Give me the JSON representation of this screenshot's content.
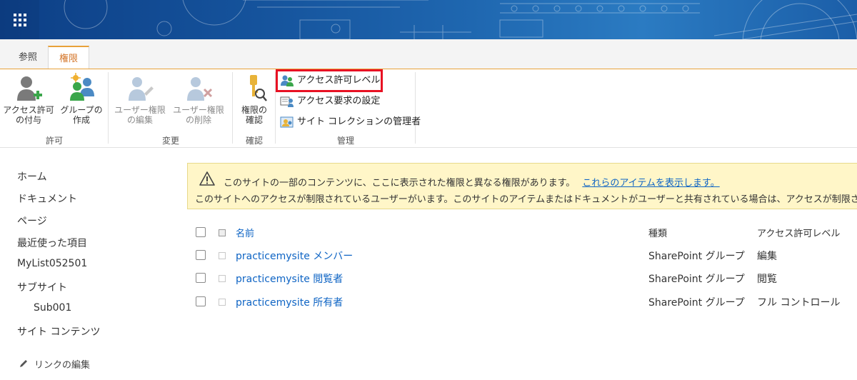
{
  "ribbon": {
    "tabs": [
      {
        "label": "参照"
      },
      {
        "label": "権限"
      }
    ],
    "groups": {
      "grant": {
        "label": "許可",
        "grant_perm": "アクセス許可\nの付与",
        "create_group": "グループの\n作成"
      },
      "modify": {
        "label": "変更",
        "edit_user_perm": "ユーザー権限\nの編集",
        "remove_user_perm": "ユーザー権限\nの削除"
      },
      "check": {
        "label": "確認",
        "check_perm": "権限の\n確認"
      },
      "manage": {
        "label": "管理",
        "permission_levels": "アクセス許可レベル",
        "access_request_settings": "アクセス要求の設定",
        "site_collection_admins": "サイト コレクションの管理者"
      }
    }
  },
  "nav": {
    "items": [
      "ホーム",
      "ドキュメント",
      "ページ",
      "最近使った項目",
      "MyList052501",
      "サブサイト"
    ],
    "sub_items": [
      "Sub001"
    ],
    "after_items": [
      "サイト コンテンツ"
    ],
    "edit_links": "リンクの編集"
  },
  "notice": {
    "line1": "このサイトの一部のコンテンツに、ここに表示された権限と異なる権限があります。",
    "link": "これらのアイテムを表示します。",
    "line2": "このサイトへのアクセスが制限されているユーザーがいます。このサイトのアイテムまたはドキュメントがユーザーと共有されている場合は、アクセスが制限されるこ"
  },
  "table": {
    "headers": {
      "name": "名前",
      "type": "種類",
      "level": "アクセス許可レベル"
    },
    "rows": [
      {
        "name": "practicemysite メンバー",
        "type": "SharePoint グループ",
        "level": "編集"
      },
      {
        "name": "practicemysite 閲覧者",
        "type": "SharePoint グループ",
        "level": "閲覧"
      },
      {
        "name": "practicemysite 所有者",
        "type": "SharePoint グループ",
        "level": "フル コントロール"
      }
    ]
  },
  "colors": {
    "accent_orange": "#e8a23a",
    "link_blue": "#0e64c4",
    "highlight_red": "#e81123",
    "notice_bg": "#fff6c8"
  },
  "icons": [
    "waffle-icon",
    "grant-permissions-icon",
    "create-group-icon",
    "edit-user-permissions-icon",
    "remove-user-permissions-icon",
    "check-permissions-icon",
    "permission-levels-icon",
    "access-request-icon",
    "site-collection-admins-icon",
    "warning-icon",
    "pencil-icon"
  ]
}
